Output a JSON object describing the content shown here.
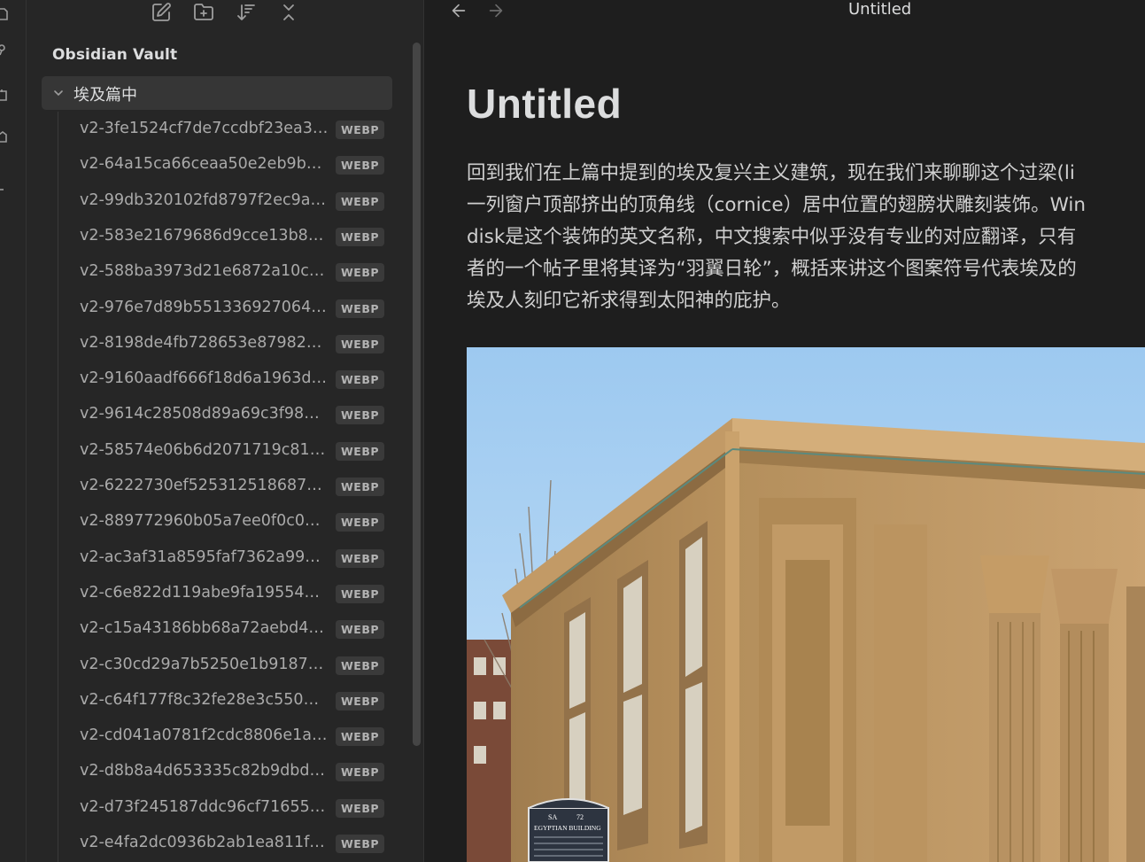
{
  "colors": {
    "background": "#1e1e1e",
    "sidebar": "#262626",
    "selected_row": "#363636",
    "badge_bg": "#3a3a3a",
    "text_primary": "#dcddde",
    "text_muted": "#aaaaaa"
  },
  "nav_header": {
    "buttons": [
      {
        "name": "new-note",
        "icon": "edit-icon"
      },
      {
        "name": "new-folder",
        "icon": "folder-plus-icon"
      },
      {
        "name": "sort",
        "icon": "sort-icon"
      },
      {
        "name": "collapse-all",
        "icon": "collapse-icon"
      }
    ]
  },
  "sidebar": {
    "vault_name": "Obsidian Vault",
    "folder": {
      "name": "埃及篇中",
      "expanded": true
    },
    "files": [
      {
        "name": "v2-3fe1524cf7de7ccdbf23ea31...",
        "ext": "WEBP"
      },
      {
        "name": "v2-64a15ca66ceaa50e2eb9b12...",
        "ext": "WEBP"
      },
      {
        "name": "v2-99db320102fd8797f2ec9aa...",
        "ext": "WEBP"
      },
      {
        "name": "v2-583e21679686d9cce13b86...",
        "ext": "WEBP"
      },
      {
        "name": "v2-588ba3973d21e6872a10cd...",
        "ext": "WEBP"
      },
      {
        "name": "v2-976e7d89b5513369270640...",
        "ext": "WEBP"
      },
      {
        "name": "v2-8198de4fb728653e87982e...",
        "ext": "WEBP"
      },
      {
        "name": "v2-9160aadf666f18d6a1963d1...",
        "ext": "WEBP"
      },
      {
        "name": "v2-9614c28508d89a69c3f9893...",
        "ext": "WEBP"
      },
      {
        "name": "v2-58574e06b6d2071719c81e...",
        "ext": "WEBP"
      },
      {
        "name": "v2-6222730ef5253125186871a...",
        "ext": "WEBP"
      },
      {
        "name": "v2-889772960b05a7ee0f0c0eb...",
        "ext": "WEBP"
      },
      {
        "name": "v2-ac3af31a8595faf7362a994a...",
        "ext": "WEBP"
      },
      {
        "name": "v2-c6e822d119abe9fa195544e...",
        "ext": "WEBP"
      },
      {
        "name": "v2-c15a43186bb68a72aebd48...",
        "ext": "WEBP"
      },
      {
        "name": "v2-c30cd29a7b5250e1b9187e...",
        "ext": "WEBP"
      },
      {
        "name": "v2-c64f177f8c32fe28e3c55088...",
        "ext": "WEBP"
      },
      {
        "name": "v2-cd041a0781f2cdc8806e1a2...",
        "ext": "WEBP"
      },
      {
        "name": "v2-d8b8a4d653335c82b9dbd8...",
        "ext": "WEBP"
      },
      {
        "name": "v2-d73f245187ddc96cf716555...",
        "ext": "WEBP"
      },
      {
        "name": "v2-e4fa2dc0936b2ab1ea811f6...",
        "ext": "WEBP"
      }
    ]
  },
  "main": {
    "view_title": "Untitled",
    "doc_title": "Untitled",
    "body_lines": [
      "回到我们在上篇中提到的埃及复兴主义建筑，现在我们来聊聊这个过梁(li",
      "一列窗户顶部挤出的顶角线（cornice）居中位置的翅膀状雕刻装饰。Win",
      "disk是这个装饰的英文名称，中文搜索中似乎没有专业的对应翻译，只有",
      "者的一个帖子里将其译为“羽翼日轮”，概括来讲这个图案符号代表埃及的",
      "埃及人刻印它祈求得到太阳神的庇护。"
    ],
    "image": {
      "sign_line1_left": "SA",
      "sign_line1_right": "72",
      "sign_line2": "EGYPTIAN BUILDING"
    }
  }
}
